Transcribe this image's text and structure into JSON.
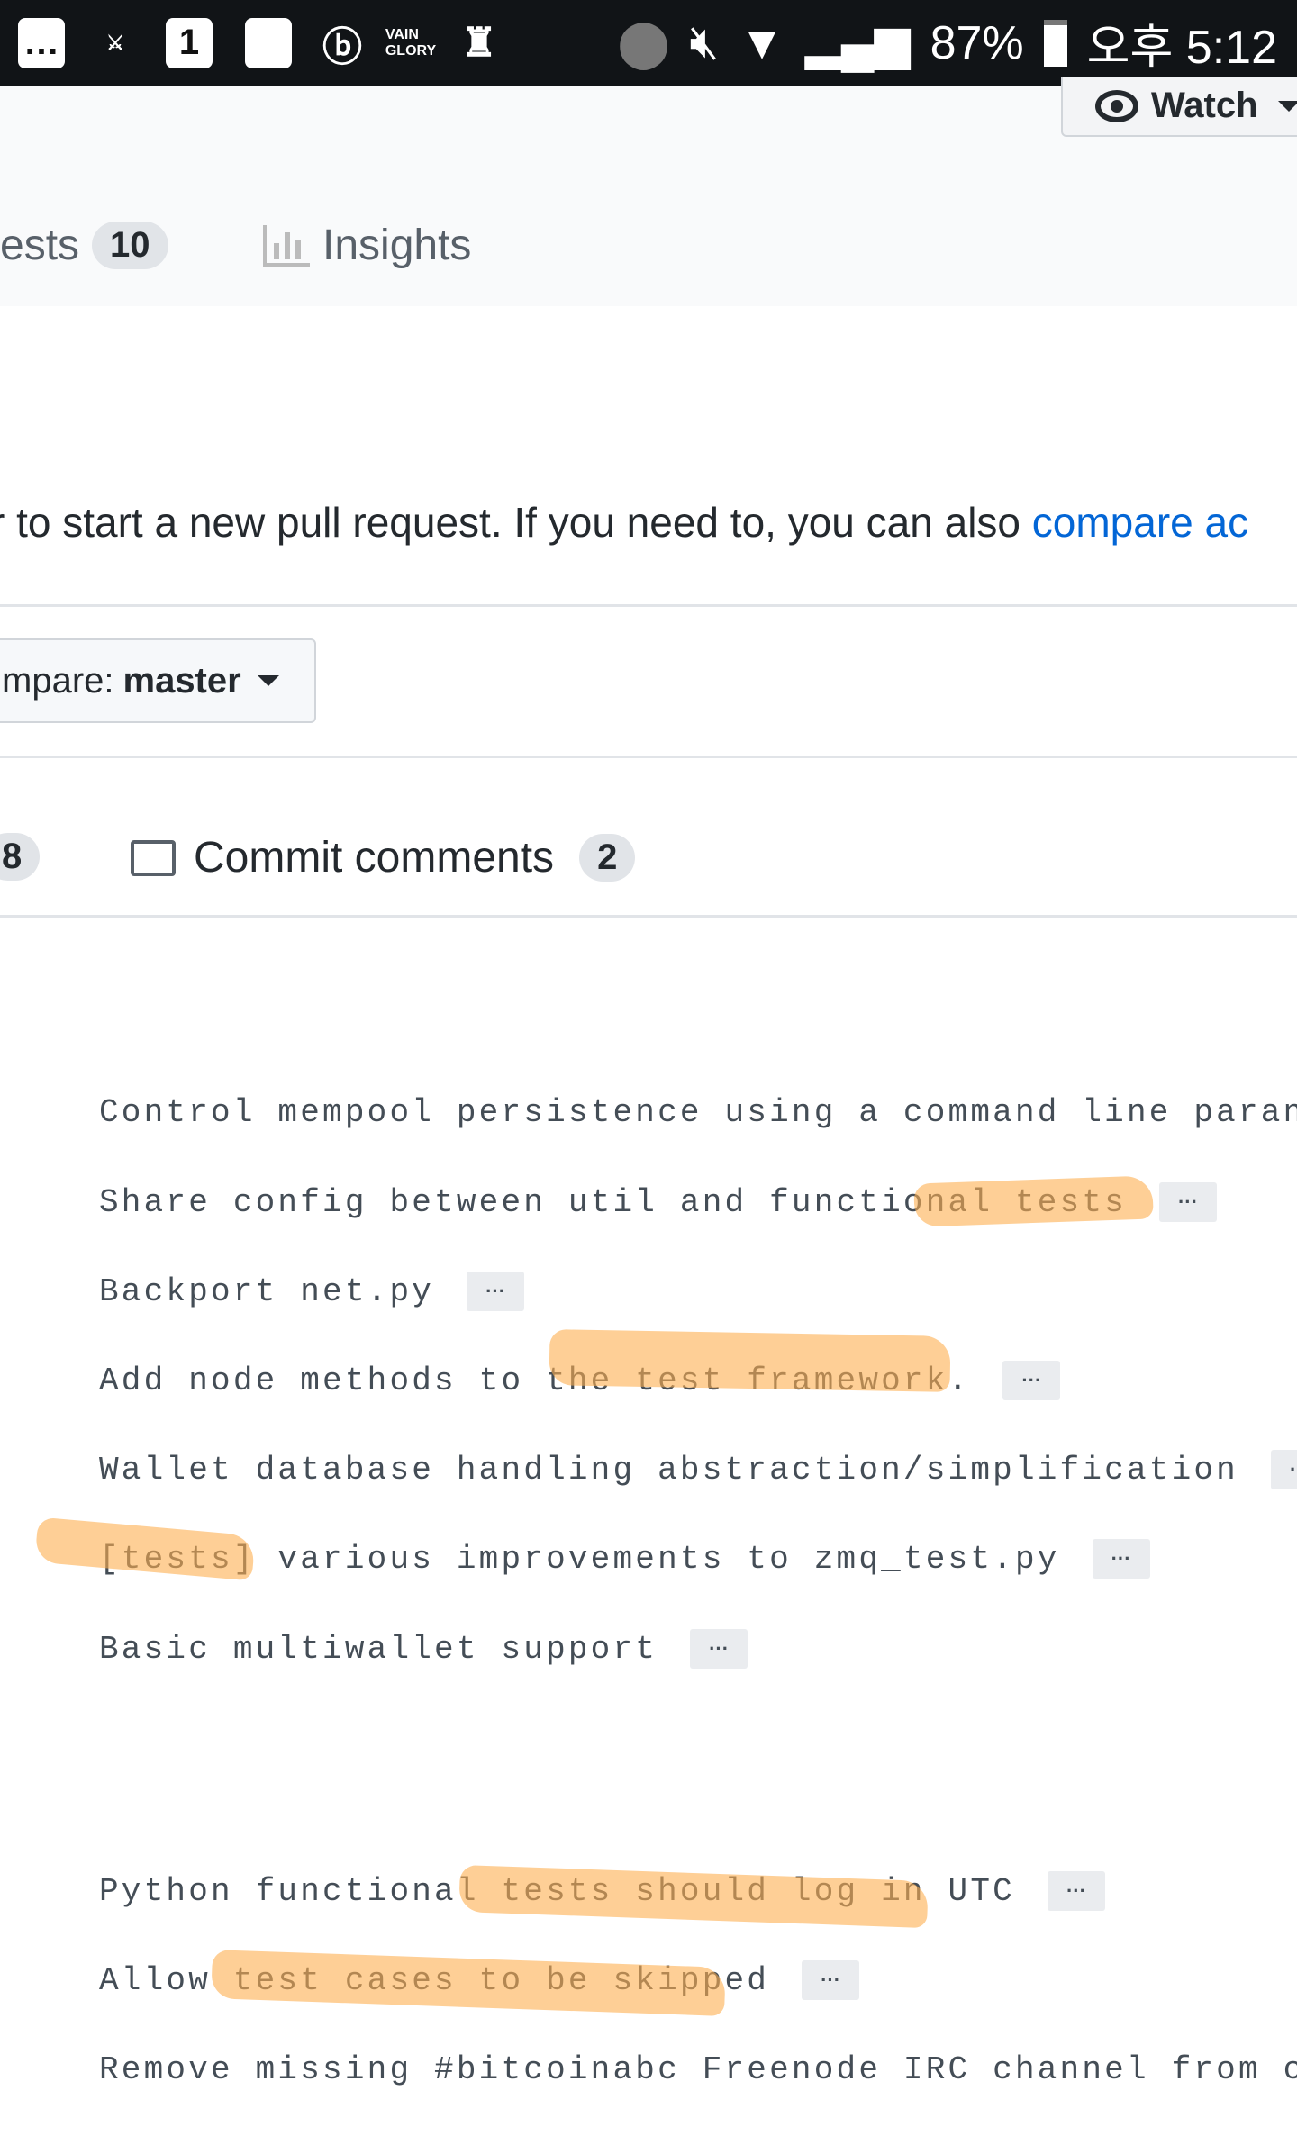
{
  "status_bar": {
    "battery": "87%",
    "time": "오후 5:12",
    "icons": [
      "chat-bubble-icon",
      "shield-icon",
      "one-icon",
      "blank-app-icon",
      "b-app-icon",
      "vainglory-icon",
      "crown-icon",
      "location-icon",
      "mute-icon",
      "wifi-lock-icon",
      "signal-icon",
      "battery-icon"
    ]
  },
  "header": {
    "watch_label": "Watch",
    "tabs": [
      {
        "label": "ests",
        "count": "10"
      },
      {
        "label": "Insights"
      }
    ]
  },
  "info": {
    "text": "r to start a new pull request. If you need to, you can also ",
    "link": "compare ac"
  },
  "compare": {
    "prefix": "mpare: ",
    "branch": "master"
  },
  "tabs2": [
    {
      "count": "8"
    },
    {
      "label": "Commit comments",
      "count": "2"
    }
  ],
  "commits": [
    {
      "message": "Control mempool persistence using a command line paran",
      "ellipsis": ""
    },
    {
      "message": "Share config between util and functional tests",
      "ellipsis": "···"
    },
    {
      "message": "Backport net.py",
      "ellipsis": "···"
    },
    {
      "message": "Add node methods to the test framework.",
      "ellipsis": "···"
    },
    {
      "message": "Wallet database handling abstraction/simplification",
      "ellipsis": "···"
    },
    {
      "message": "[tests] various improvements to zmq_test.py",
      "ellipsis": "···"
    },
    {
      "message": "Basic multiwallet support",
      "ellipsis": "···"
    },
    {
      "message": "Python functional tests should log in UTC",
      "ellipsis": "···"
    },
    {
      "message": "Allow test cases to be skipped",
      "ellipsis": "···"
    },
    {
      "message": "Remove missing #bitcoinabc Freenode IRC channel from c",
      "ellipsis": ""
    }
  ],
  "colors": {
    "link": "#0366d6",
    "highlight": "#fdb96a",
    "status_bar": "#111417"
  }
}
